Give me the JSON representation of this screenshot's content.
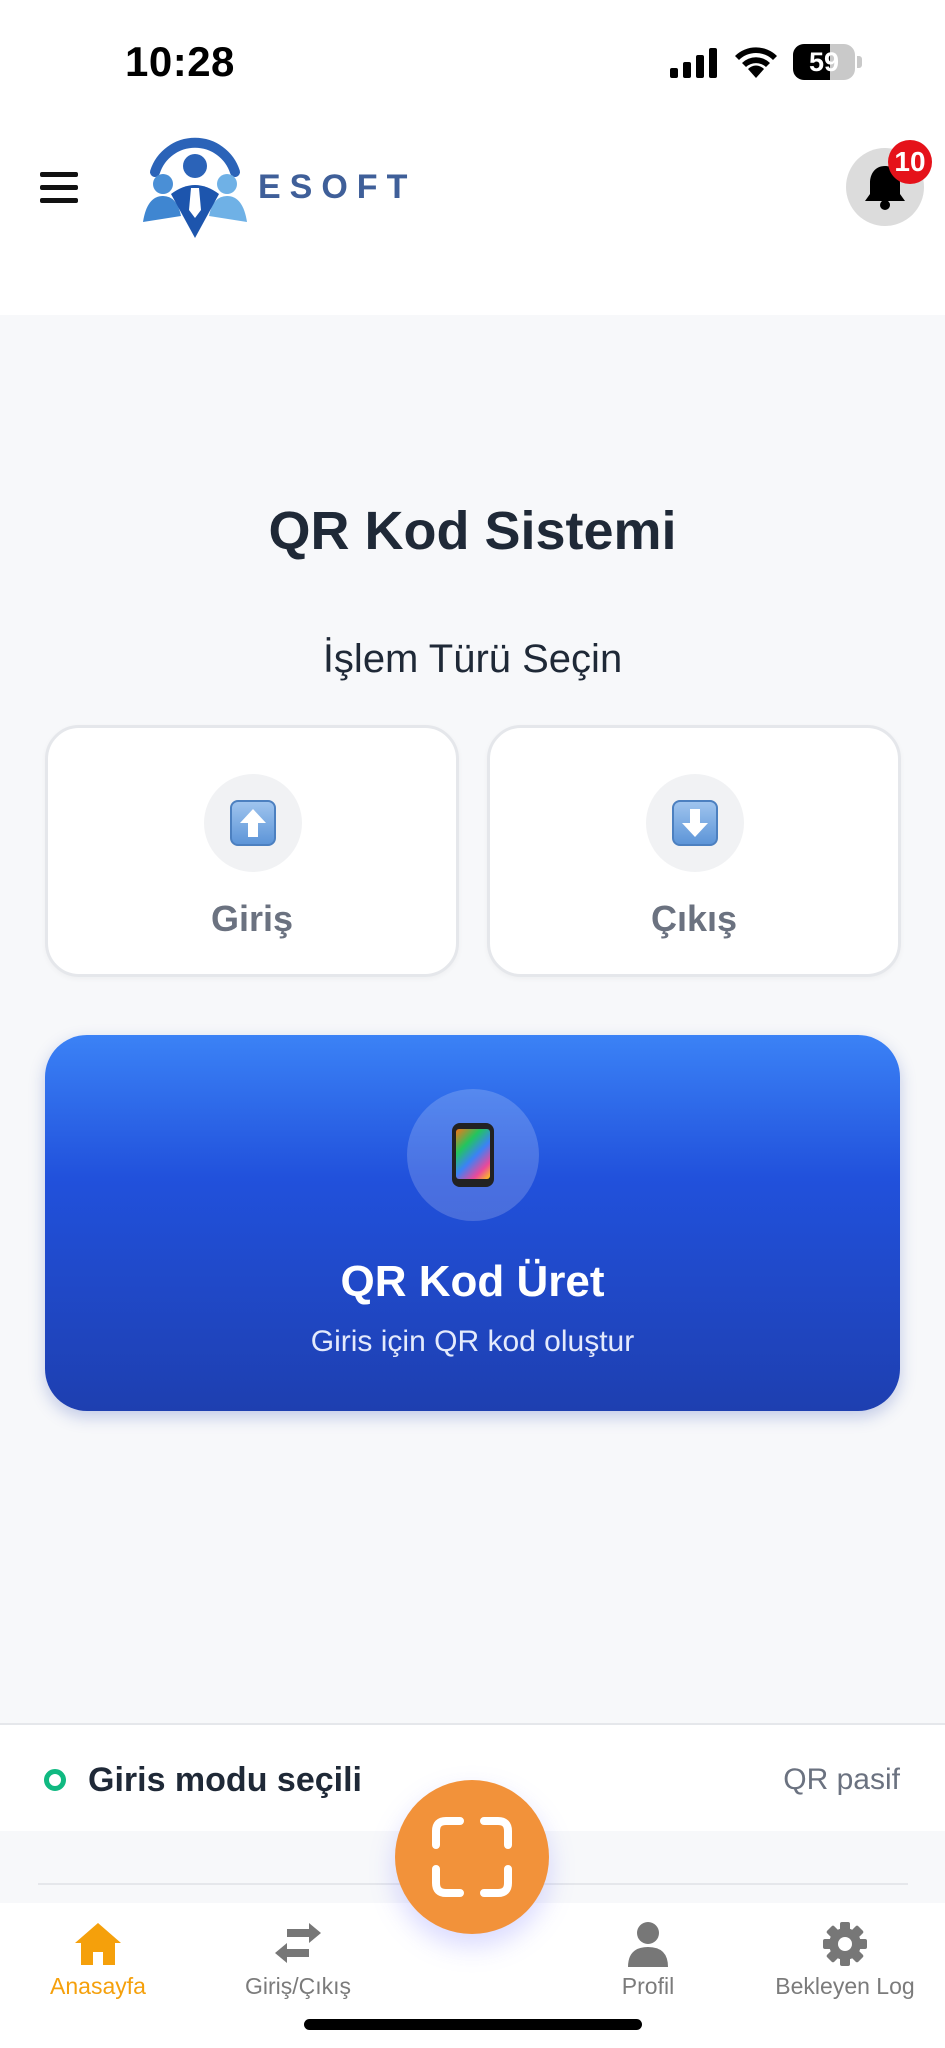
{
  "status_bar": {
    "time": "10:28",
    "battery": "59"
  },
  "header": {
    "logo_text": "ESOFT",
    "notification_count": "10"
  },
  "main": {
    "title": "QR Kod Sistemi",
    "section_title": "İşlem Türü Seçin",
    "options": [
      {
        "label": "Giriş",
        "icon": "up-arrow-icon"
      },
      {
        "label": "Çıkış",
        "icon": "down-arrow-icon"
      }
    ],
    "qr_card": {
      "title": "QR Kod Üret",
      "subtitle": "Giris için QR kod oluştur",
      "icon": "mobile-phone-icon"
    }
  },
  "mode_bar": {
    "mode_text": "Giris modu seçili",
    "qr_status": "QR pasif"
  },
  "nav": {
    "items": [
      {
        "label": "Anasayfa",
        "icon": "home-icon",
        "active": true
      },
      {
        "label": "Giriş/Çıkış",
        "icon": "swap-icon",
        "active": false
      },
      {
        "label": "Profil",
        "icon": "user-icon",
        "active": false
      },
      {
        "label": "Bekleyen Log",
        "icon": "gear-icon",
        "active": false
      }
    ]
  },
  "colors": {
    "accent_orange": "#f2923a",
    "active_nav": "#f5a00b",
    "primary_blue": "#2151dc",
    "badge_red": "#e5121a",
    "mode_green": "#10b981"
  }
}
